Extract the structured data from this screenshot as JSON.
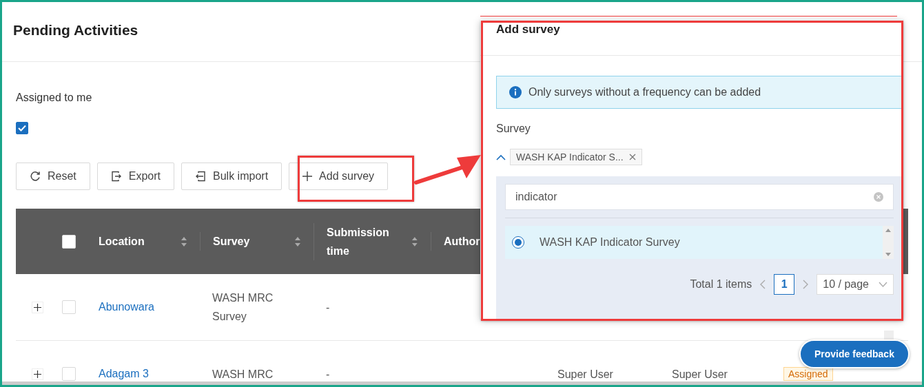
{
  "page": {
    "title": "Pending Activities"
  },
  "filter": {
    "label": "Assigned to me",
    "checked": true
  },
  "toolbar": [
    {
      "label": "Reset"
    },
    {
      "label": "Export"
    },
    {
      "label": "Bulk import"
    },
    {
      "label": "Add survey"
    }
  ],
  "table": {
    "header_checked": false,
    "columns": [
      {
        "label": "Location",
        "sortable": true
      },
      {
        "label": "Survey",
        "sortable": true
      },
      {
        "label": "Submission time",
        "sortable": true
      },
      {
        "label": "Author"
      }
    ],
    "rows": [
      {
        "expanded": false,
        "checked": false,
        "location": "Abunowara",
        "survey": "WASH MRC Survey",
        "submission_time": "-"
      },
      {
        "expanded": false,
        "checked": false,
        "location": "Adagam 3",
        "survey": "WASH MRC",
        "submission_time": "-",
        "column_6": "Super User",
        "column_7": "Super User",
        "status": "Assigned"
      }
    ]
  },
  "dialog": {
    "title": "Add survey",
    "notice": "Only surveys without a frequency can be added",
    "field_label": "Survey",
    "expanded": true,
    "tag": "WASH KAP Indicator S...",
    "search": "indicator",
    "options": [
      {
        "label": "WASH KAP Indicator Survey",
        "selected": true
      }
    ],
    "pagination": {
      "total": "Total 1 items",
      "pages": [
        {
          "label": "1",
          "selected": true
        }
      ],
      "page_size": "10 / page"
    }
  },
  "feedback_button": "Provide feedback"
}
